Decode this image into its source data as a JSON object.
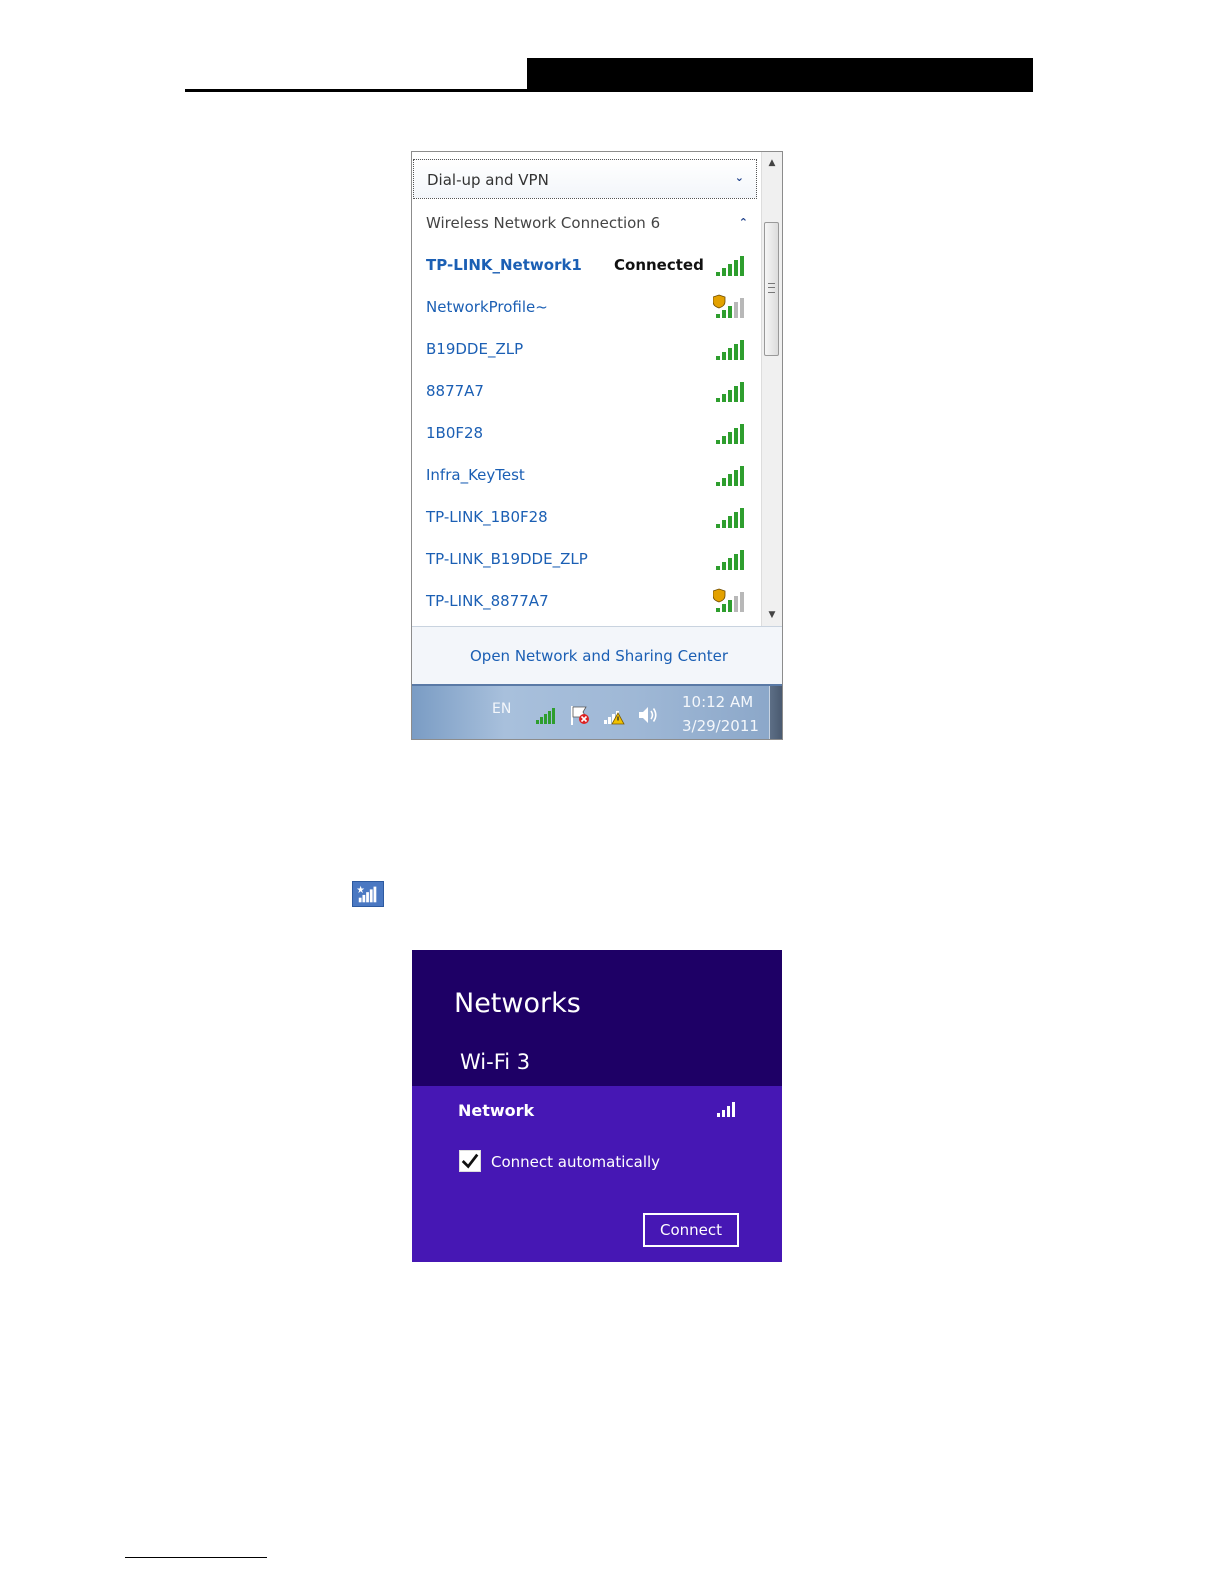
{
  "win7_flyout": {
    "dialup_label": "Dial-up and VPN",
    "section_title": "Wireless Network Connection 6",
    "networks": [
      {
        "name": "TP-LINK_Network1",
        "status": "Connected",
        "connected": true,
        "secured": false
      },
      {
        "name": "NetworkProfile~",
        "status": "",
        "connected": false,
        "secured": true
      },
      {
        "name": "B19DDE_ZLP",
        "status": "",
        "connected": false,
        "secured": false
      },
      {
        "name": "8877A7",
        "status": "",
        "connected": false,
        "secured": false
      },
      {
        "name": "1B0F28",
        "status": "",
        "connected": false,
        "secured": false
      },
      {
        "name": "Infra_KeyTest",
        "status": "",
        "connected": false,
        "secured": false
      },
      {
        "name": "TP-LINK_1B0F28",
        "status": "",
        "connected": false,
        "secured": false
      },
      {
        "name": "TP-LINK_B19DDE_ZLP",
        "status": "",
        "connected": false,
        "secured": false
      },
      {
        "name": "TP-LINK_8877A7",
        "status": "",
        "connected": false,
        "secured": true
      }
    ],
    "footer_link": "Open Network and Sharing Center",
    "taskbar": {
      "language": "EN",
      "time": "10:12 AM",
      "date": "3/29/2011"
    }
  },
  "win8_panel": {
    "title": "Networks",
    "adapter": "Wi-Fi 3",
    "network_name": "Network",
    "connect_auto_label": "Connect automatically",
    "connect_auto_checked": true,
    "connect_button": "Connect"
  },
  "colors": {
    "win7_link": "#1b5fb4",
    "win8_header": "#1e0066",
    "win8_body": "#4617b4",
    "signal_green": "#2e9e2e"
  }
}
